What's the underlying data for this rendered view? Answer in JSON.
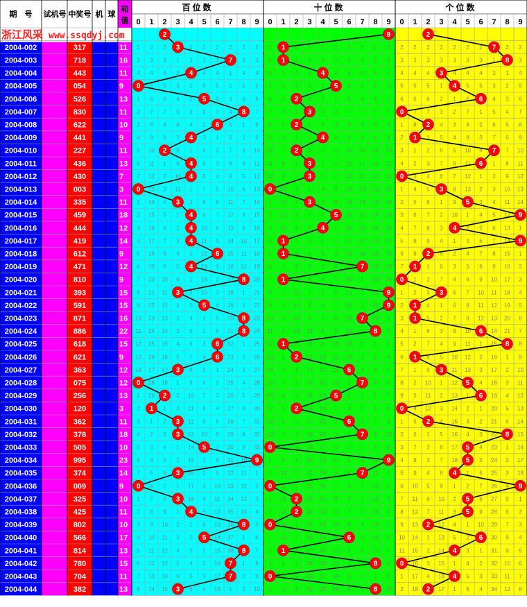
{
  "header": {
    "period_label": "期　号",
    "trial_label": "试机号",
    "draw_label": "中奖号",
    "machine_label": "机",
    "ball_label": "球",
    "sum_label_1": "和",
    "sum_label_2": "值",
    "hundreds_label": "百位数",
    "tens_label": "十位数",
    "units_label": "个位数"
  },
  "brand": {
    "name": "浙江风采",
    "site": "www.ssqdyj.com"
  },
  "digits": [
    "0",
    "1",
    "2",
    "3",
    "4",
    "5",
    "6",
    "7",
    "8",
    "9"
  ],
  "colors": {
    "period_bg": "#0000ff",
    "trial_bg": "#ff00ff",
    "draw_bg": "#ff0000",
    "sum_bg": "#ff00ff",
    "hundreds_bg": "#00ffff",
    "tens_bg": "#00ff00",
    "units_bg": "#ffff00",
    "ball": "#ff0000"
  },
  "chart_data": {
    "type": "table",
    "columns": [
      "期号",
      "中奖号",
      "和值",
      "百位数",
      "十位数",
      "个位数"
    ],
    "rows": [
      {
        "period": "2004-002",
        "number": "317",
        "sum": "11"
      },
      {
        "period": "2004-003",
        "number": "718",
        "sum": "16"
      },
      {
        "period": "2004-004",
        "number": "443",
        "sum": "11"
      },
      {
        "period": "2004-005",
        "number": "054",
        "sum": "9"
      },
      {
        "period": "2004-006",
        "number": "526",
        "sum": "13"
      },
      {
        "period": "2004-007",
        "number": "830",
        "sum": "11"
      },
      {
        "period": "2004-008",
        "number": "622",
        "sum": "10"
      },
      {
        "period": "2004-009",
        "number": "441",
        "sum": "9"
      },
      {
        "period": "2004-010",
        "number": "227",
        "sum": "11"
      },
      {
        "period": "2004-011",
        "number": "436",
        "sum": "13"
      },
      {
        "period": "2004-012",
        "number": "430",
        "sum": "7"
      },
      {
        "period": "2004-013",
        "number": "003",
        "sum": "3"
      },
      {
        "period": "2004-014",
        "number": "335",
        "sum": "11"
      },
      {
        "period": "2004-015",
        "number": "459",
        "sum": "18"
      },
      {
        "period": "2004-016",
        "number": "444",
        "sum": "12"
      },
      {
        "period": "2004-017",
        "number": "419",
        "sum": "14"
      },
      {
        "period": "2004-018",
        "number": "612",
        "sum": "9"
      },
      {
        "period": "2004-019",
        "number": "471",
        "sum": "12"
      },
      {
        "period": "2004-020",
        "number": "810",
        "sum": "9"
      },
      {
        "period": "2004-021",
        "number": "393",
        "sum": "15"
      },
      {
        "period": "2004-022",
        "number": "591",
        "sum": "15"
      },
      {
        "period": "2004-023",
        "number": "871",
        "sum": "16"
      },
      {
        "period": "2004-024",
        "number": "886",
        "sum": "22"
      },
      {
        "period": "2004-025",
        "number": "618",
        "sum": "15"
      },
      {
        "period": "2004-026",
        "number": "621",
        "sum": "9"
      },
      {
        "period": "2004-027",
        "number": "363",
        "sum": "12"
      },
      {
        "period": "2004-028",
        "number": "075",
        "sum": "12"
      },
      {
        "period": "2004-029",
        "number": "256",
        "sum": "13"
      },
      {
        "period": "2004-030",
        "number": "120",
        "sum": "3"
      },
      {
        "period": "2004-031",
        "number": "362",
        "sum": "11"
      },
      {
        "period": "2004-032",
        "number": "378",
        "sum": "18"
      },
      {
        "period": "2004-033",
        "number": "505",
        "sum": "10"
      },
      {
        "period": "2004-034",
        "number": "995",
        "sum": "23"
      },
      {
        "period": "2004-035",
        "number": "374",
        "sum": "14"
      },
      {
        "period": "2004-036",
        "number": "009",
        "sum": "9"
      },
      {
        "period": "2004-037",
        "number": "325",
        "sum": "10"
      },
      {
        "period": "2004-038",
        "number": "425",
        "sum": "11"
      },
      {
        "period": "2004-039",
        "number": "802",
        "sum": "10"
      },
      {
        "period": "2004-040",
        "number": "566",
        "sum": "17"
      },
      {
        "period": "2004-041",
        "number": "814",
        "sum": "13"
      },
      {
        "period": "2004-042",
        "number": "780",
        "sum": "15"
      },
      {
        "period": "2004-043",
        "number": "704",
        "sum": "11"
      },
      {
        "period": "2004-044",
        "number": "382",
        "sum": "13"
      }
    ],
    "first_row_tails": {
      "hundreds": "2",
      "tens": "9",
      "units": "2"
    }
  }
}
